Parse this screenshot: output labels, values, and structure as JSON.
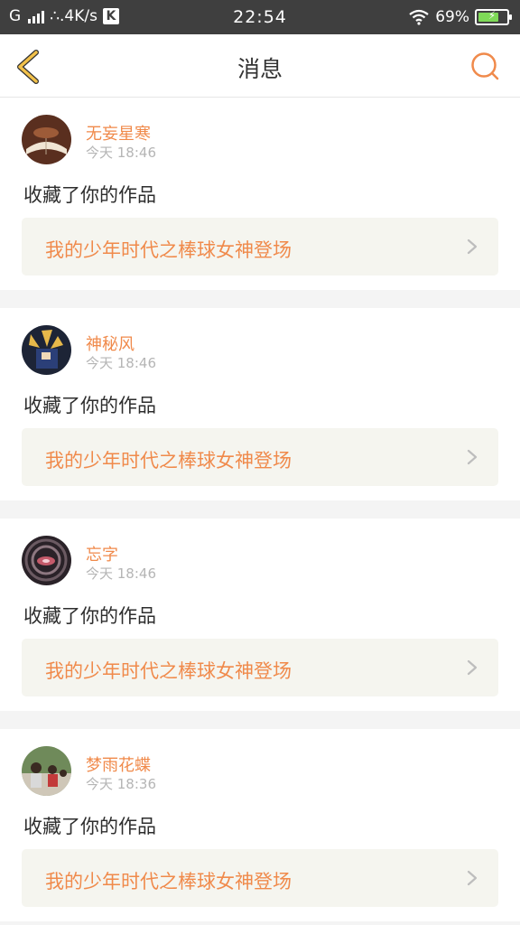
{
  "status_bar": {
    "carrier": "G",
    "network_speed": "∴.4K/s",
    "k_badge": "K",
    "time": "22:54",
    "battery": "69%",
    "battery_level": 0.69
  },
  "header": {
    "title": "消息"
  },
  "messages": [
    {
      "username": "无妄星寒",
      "time": "今天 18:46",
      "action": "收藏了你的作品",
      "work_title": "我的少年时代之棒球女神登场"
    },
    {
      "username": "神秘风",
      "time": "今天 18:46",
      "action": "收藏了你的作品",
      "work_title": "我的少年时代之棒球女神登场"
    },
    {
      "username": "忘字",
      "time": "今天 18:46",
      "action": "收藏了你的作品",
      "work_title": "我的少年时代之棒球女神登场"
    },
    {
      "username": "梦雨花蝶",
      "time": "今天 18:36",
      "action": "收藏了你的作品",
      "work_title": "我的少年时代之棒球女神登场"
    }
  ],
  "colors": {
    "accent": "#f08a4b",
    "status_bar": "#3f3f3f",
    "back_arrow": "#f2c14a"
  }
}
